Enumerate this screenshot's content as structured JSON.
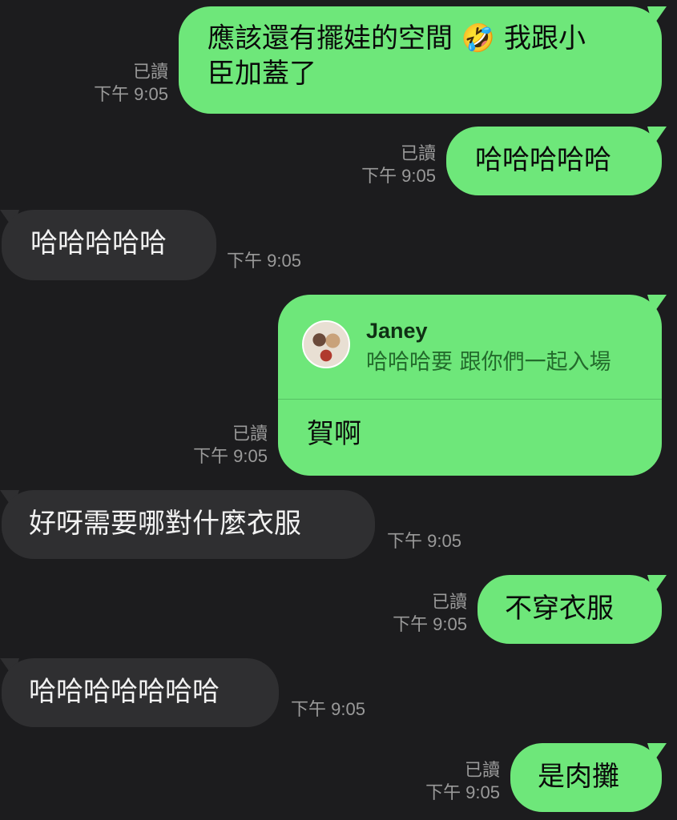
{
  "messages": [
    {
      "id": "m1",
      "direction": "out",
      "text": "應該還有擺娃的空間 🤣 我跟小臣加蓋了",
      "line1": "應該還有擺娃的空間 🤣 我跟小",
      "line2": "臣加蓋了",
      "read": "已讀",
      "time": "下午 9:05"
    },
    {
      "id": "m2",
      "direction": "out",
      "text": "哈哈哈哈哈",
      "read": "已讀",
      "time": "下午 9:05"
    },
    {
      "id": "m3",
      "direction": "in",
      "text": "哈哈哈哈哈",
      "time": "下午 9:05"
    },
    {
      "id": "m4",
      "direction": "out",
      "reply": {
        "name": "Janey",
        "text": "哈哈哈要 跟你們一起入場"
      },
      "text": "賀啊",
      "read": "已讀",
      "time": "下午 9:05"
    },
    {
      "id": "m5",
      "direction": "in",
      "text": "好呀需要哪對什麼衣服",
      "time": "下午 9:05"
    },
    {
      "id": "m6",
      "direction": "out",
      "text": "不穿衣服",
      "read": "已讀",
      "time": "下午 9:05"
    },
    {
      "id": "m7",
      "direction": "in",
      "text": "哈哈哈哈哈哈哈",
      "time": "下午 9:05"
    },
    {
      "id": "m8",
      "direction": "out",
      "text": "是肉攤",
      "read": "已讀",
      "time": "下午 9:05"
    }
  ],
  "colors": {
    "background": "#1c1c1e",
    "outgoing_bubble": "#6ee77a",
    "incoming_bubble": "#2f2f31",
    "meta_text": "#9a9a9a"
  },
  "icons": {
    "reply_avatar": "avatar-icon"
  }
}
